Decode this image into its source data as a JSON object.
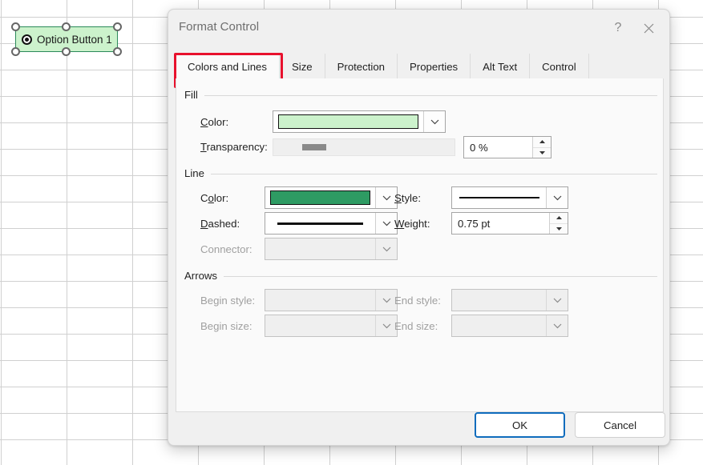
{
  "sheet": {
    "option_button": {
      "label": "Option Button 1",
      "fill_color": "#CCF2CC",
      "border_color": "#2C8A5A",
      "selected": true,
      "handles": 6
    }
  },
  "dialog": {
    "title": "Format Control",
    "help_icon": "question-mark-icon",
    "close_icon": "close-icon",
    "tabs": [
      {
        "label": "Colors and Lines",
        "active": true
      },
      {
        "label": "Size",
        "active": false
      },
      {
        "label": "Protection",
        "active": false
      },
      {
        "label": "Properties",
        "active": false
      },
      {
        "label": "Alt Text",
        "active": false
      },
      {
        "label": "Control",
        "active": false
      }
    ],
    "highlight_color": "#E8112D",
    "fill": {
      "group_label": "Fill",
      "color_label": "Color:",
      "color_value": "#CCF2CC",
      "transparency_label": "Transparency:",
      "transparency_value": "0 %",
      "transparency_slider_position": 0
    },
    "line": {
      "group_label": "Line",
      "color_label": "Color:",
      "color_value": "#2E9B63",
      "dashed_label": "Dashed:",
      "dashed_value": "solid-line",
      "style_label": "Style:",
      "style_value": "single-thin-line",
      "weight_label": "Weight:",
      "weight_value": "0.75 pt",
      "connector_label": "Connector:",
      "connector_value": "",
      "connector_disabled": true
    },
    "arrows": {
      "group_label": "Arrows",
      "begin_style_label": "Begin style:",
      "begin_style_value": "",
      "end_style_label": "End style:",
      "end_style_value": "",
      "begin_size_label": "Begin size:",
      "begin_size_value": "",
      "end_size_label": "End size:",
      "end_size_value": "",
      "all_disabled": true
    },
    "footer": {
      "ok_label": "OK",
      "cancel_label": "Cancel",
      "default_button": "OK",
      "accent_color": "#0F6CBD"
    }
  }
}
